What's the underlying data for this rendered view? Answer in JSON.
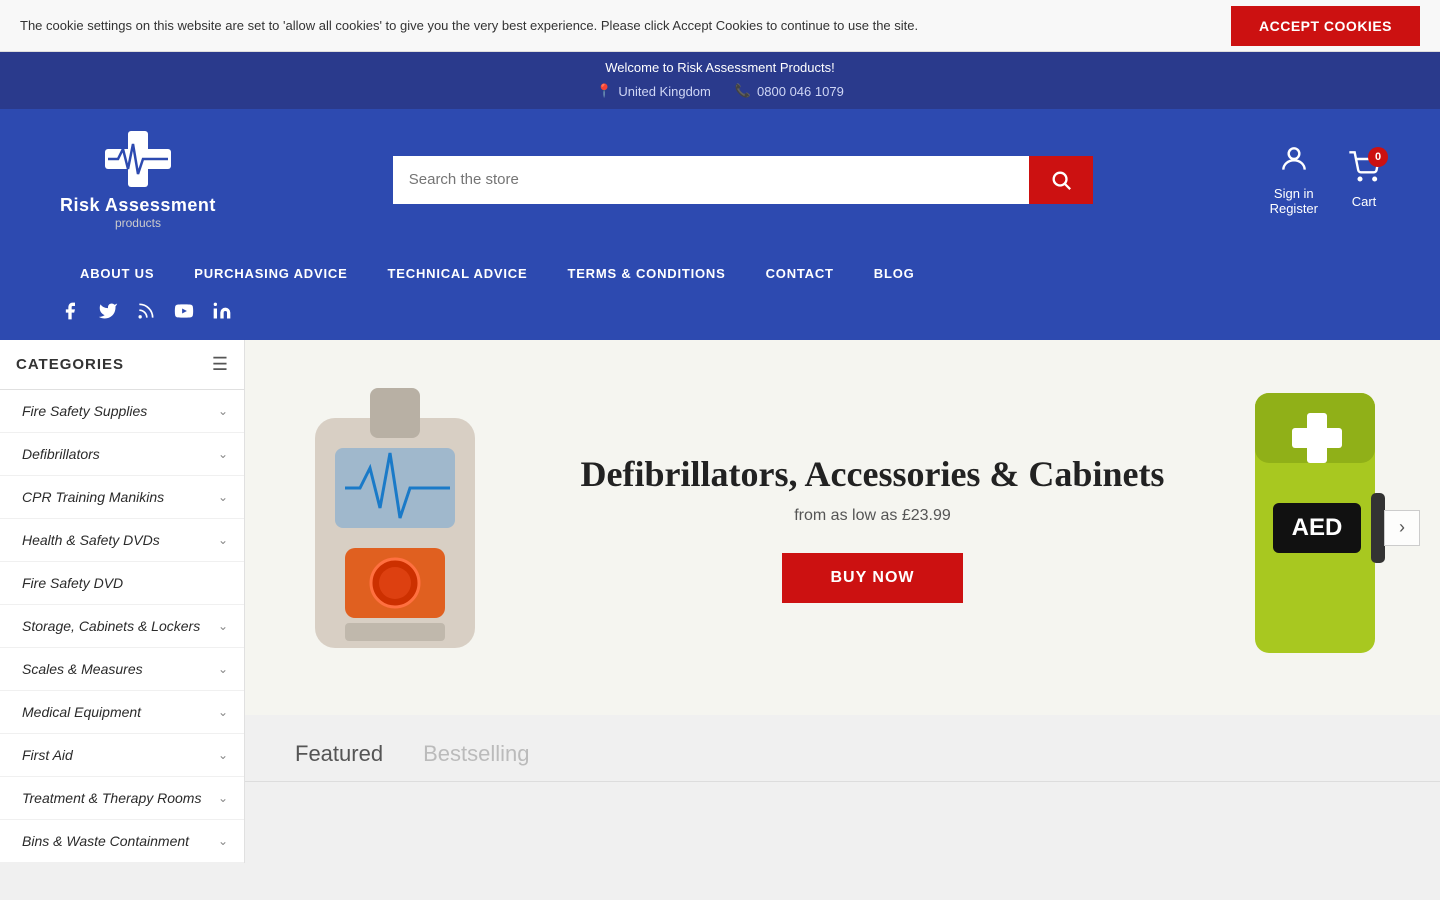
{
  "cookie": {
    "message": "The cookie settings on this website are set to 'allow all cookies' to give you the very best experience. Please click Accept Cookies to continue to use the site.",
    "accept_label": "ACCEPT COOKIES"
  },
  "topbar": {
    "welcome": "Welcome to Risk Assessment Products!",
    "country": "United Kingdom",
    "phone": "0800 046 1079"
  },
  "logo": {
    "name": "Risk Assessment",
    "sub": "products"
  },
  "search": {
    "placeholder": "Search the store"
  },
  "header_right": {
    "sign_in": "Sign in",
    "register": "Register",
    "cart": "Cart",
    "cart_count": "0"
  },
  "nav": {
    "items": [
      {
        "label": "ABOUT US"
      },
      {
        "label": "PURCHASING ADVICE"
      },
      {
        "label": "TECHNICAL ADVICE"
      },
      {
        "label": "TERMS & CONDITIONS"
      },
      {
        "label": "CONTACT"
      },
      {
        "label": "BLOG"
      }
    ]
  },
  "social": {
    "icons": [
      {
        "name": "facebook",
        "glyph": "f"
      },
      {
        "name": "twitter",
        "glyph": "t"
      },
      {
        "name": "rss",
        "glyph": "r"
      },
      {
        "name": "youtube",
        "glyph": "y"
      },
      {
        "name": "linkedin",
        "glyph": "in"
      }
    ]
  },
  "sidebar": {
    "header": "CATEGORIES",
    "items": [
      {
        "label": "Fire Safety Supplies"
      },
      {
        "label": "Defibrillators"
      },
      {
        "label": "CPR Training Manikins"
      },
      {
        "label": "Health & Safety DVDs"
      },
      {
        "label": "Fire Safety DVD"
      },
      {
        "label": "Storage, Cabinets & Lockers"
      },
      {
        "label": "Scales & Measures"
      },
      {
        "label": "Medical Equipment"
      },
      {
        "label": "First Aid"
      },
      {
        "label": "Treatment & Therapy Rooms"
      },
      {
        "label": "Bins & Waste Containment"
      }
    ]
  },
  "hero": {
    "title": "Defibrillators, Accessories & Cabinets",
    "subtitle": "from as low as £23.99",
    "buy_now": "BUY NOW"
  },
  "tabs": [
    {
      "label": "Featured"
    },
    {
      "label": "Bestselling"
    }
  ]
}
